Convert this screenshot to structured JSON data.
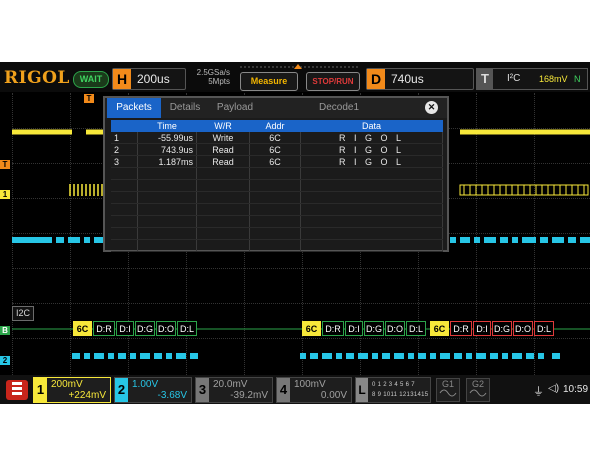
{
  "topbar": {
    "logo": "RIGOL",
    "status": "WAIT",
    "horizontal": {
      "letter": "H",
      "value": "200us"
    },
    "sample_rate": "2.5GSa/s",
    "memory_depth": "5Mpts",
    "measure_label": "Measure",
    "stoprun_label": "STOP/RUN",
    "delay": {
      "letter": "D",
      "value": "740us"
    },
    "trigger": {
      "letter": "T",
      "source": "I²C",
      "level": "168mV",
      "mode": "N"
    }
  },
  "dialog": {
    "tabs": [
      "Packets",
      "Details",
      "Payload",
      "Decode1"
    ],
    "close_label": "✕",
    "headers": [
      "",
      "Time",
      "W/R",
      "Addr",
      "Data"
    ],
    "rows": [
      {
        "num": "1",
        "time": "-55.99us",
        "wr": "Write",
        "addr": "6C",
        "data": "R I G O L"
      },
      {
        "num": "2",
        "time": "743.9us",
        "wr": "Read",
        "addr": "6C",
        "data": "R I G O L"
      },
      {
        "num": "3",
        "time": "1.187ms",
        "wr": "Read",
        "addr": "6C",
        "data": "R I G O L"
      }
    ]
  },
  "bus": {
    "label": "I2C",
    "frame1": [
      "6C",
      "D:R",
      "D:I",
      "D:G",
      "D:O",
      "D:L"
    ],
    "frame2": [
      "6C",
      "D:R",
      "D:I",
      "D:G",
      "D:O",
      "D:L"
    ],
    "frame3": [
      "6C",
      "D:R",
      "D:I",
      "D:G",
      "D:O",
      "D:L"
    ]
  },
  "channels": [
    {
      "num": "1",
      "scale": "200mV",
      "offset": "+224mV",
      "color": "#f7e83a"
    },
    {
      "num": "2",
      "scale": "1.00V",
      "offset": "-3.68V",
      "color": "#27c6e6"
    },
    {
      "num": "3",
      "scale": "20.0mV",
      "offset": "-39.2mV",
      "color": "#a0a0a0"
    },
    {
      "num": "4",
      "scale": "100mV",
      "offset": "0.00V",
      "color": "#a0a0a0"
    }
  ],
  "logic": {
    "letter": "L",
    "row1": "0 1 2 3 4 5 6 7",
    "row2": "8 9 1011 12131415"
  },
  "generators": [
    "G1",
    "G2"
  ],
  "clock": "10:59",
  "colors": {
    "ch1": "#f7e83a",
    "ch2": "#27c6e6",
    "accent": "#1a64c8",
    "bus": "#2ca44a"
  }
}
